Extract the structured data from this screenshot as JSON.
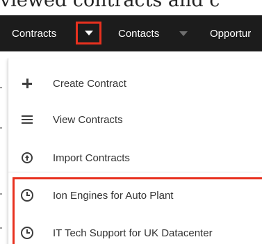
{
  "context_text": "viewed contracts and c",
  "nav": {
    "contracts": "Contracts",
    "contacts": "Contacts",
    "opportunities": "Opportur"
  },
  "dropdown": {
    "items": [
      {
        "label": "Create Contract",
        "icon": "plus-icon"
      },
      {
        "label": "View Contracts",
        "icon": "list-icon"
      },
      {
        "label": "Import Contracts",
        "icon": "upload-icon"
      },
      {
        "label": "Ion Engines for Auto Plant",
        "icon": "clock-icon"
      },
      {
        "label": "IT Tech Support for UK Datacenter",
        "icon": "clock-icon"
      }
    ]
  },
  "colors": {
    "navbar": "#1c1c1c",
    "highlight": "#e8311f",
    "icon": "#3d3d3d"
  }
}
